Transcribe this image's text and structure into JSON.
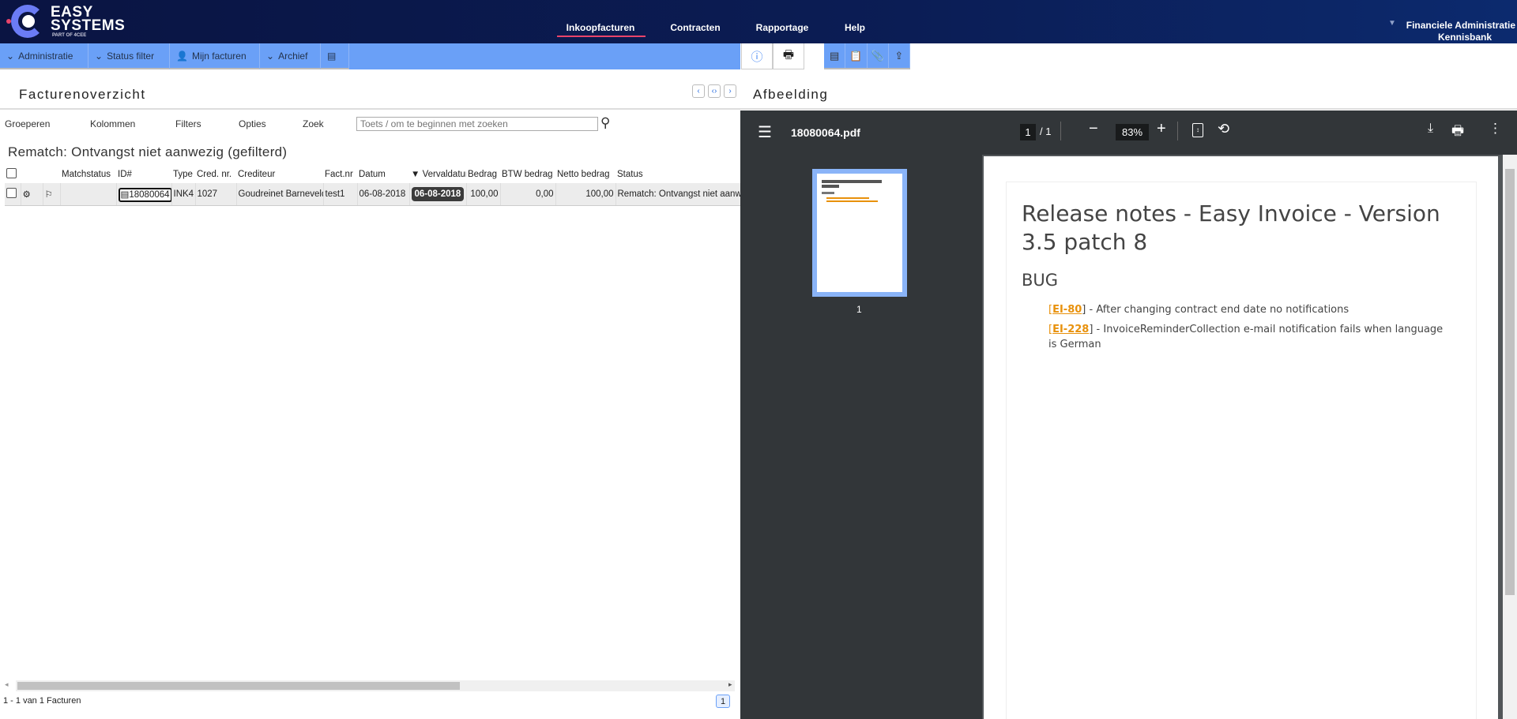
{
  "header": {
    "logo_line1": "EASY",
    "logo_line2": "SYSTEMS",
    "logo_sub": "PART OF 4CEE",
    "nav": [
      {
        "label": "Inkoopfacturen",
        "active": true
      },
      {
        "label": "Contracten"
      },
      {
        "label": "Rapportage"
      },
      {
        "label": "Help"
      }
    ],
    "user_line1": "Financiele Administratie",
    "user_line2": "Kennisbank"
  },
  "toolbar": {
    "items": [
      {
        "label": "Administratie",
        "icon": "chevron-down-icon"
      },
      {
        "label": "Status filter",
        "icon": "chevron-down-icon"
      },
      {
        "label": "Mijn facturen",
        "icon": "user-icon"
      },
      {
        "label": "Archief",
        "icon": "chevron-down-icon"
      }
    ],
    "accent": "#6aa0f7"
  },
  "left": {
    "title": "Facturenoverzicht",
    "tools": [
      "Groeperen",
      "Kolommen",
      "Filters",
      "Opties",
      "Zoek"
    ],
    "search_placeholder": "Toets / om te beginnen met zoeken",
    "subtitle": "Rematch: Ontvangst niet aanwezig (gefilterd)",
    "columns": [
      "Matchstatus",
      "ID#",
      "Type",
      "Cred. nr.",
      "Crediteur",
      "Fact.nr",
      "Datum",
      "Vervaldatum",
      "Bedrag",
      "BTW bedrag",
      "Netto bedrag",
      "Status"
    ],
    "rows": [
      {
        "id": "18080064",
        "type": "INK4",
        "cred_nr": "1027",
        "crediteur": "Goudreinet Barneveld",
        "fact_nr": "test1",
        "datum": "06-08-2018",
        "vervaldatum": "06-08-2018",
        "bedrag": "100,00",
        "btw": "0,00",
        "netto": "100,00",
        "status": "Rematch: Ontvangst niet aanwezig"
      }
    ],
    "footer": "1 - 1 van 1 Facturen",
    "page": "1"
  },
  "right": {
    "title": "Afbeelding",
    "viewer": {
      "filename": "18080064.pdf",
      "page_current": "1",
      "page_total": "/ 1",
      "zoom": "83%",
      "thumb_label": "1"
    },
    "doc": {
      "title": "Release notes - Easy Invoice - Version 3.5 patch 8",
      "section": "BUG",
      "items": [
        {
          "key": "EI-80",
          "text": "] - After changing contract end date no notifications"
        },
        {
          "key": "EI-228",
          "text": "] - InvoiceReminderCollection e-mail notification fails when language is German"
        }
      ],
      "link_color": "#e8910c"
    }
  }
}
